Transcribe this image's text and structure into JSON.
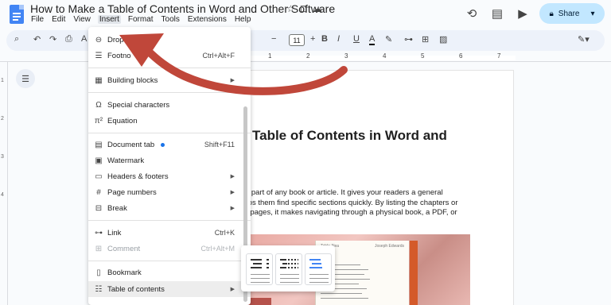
{
  "app": {
    "title": "How to Make a Table of Contents in Word and Other Software",
    "menus": [
      "File",
      "Edit",
      "View",
      "Insert",
      "Format",
      "Tools",
      "Extensions",
      "Help"
    ],
    "active_menu": "Insert",
    "share_label": "Share"
  },
  "toolbar": {
    "font_size": "11"
  },
  "ruler": {
    "numbers": [
      "1",
      "2",
      "3",
      "4",
      "5",
      "6",
      "7"
    ],
    "left_numbers": [
      "1",
      "2",
      "3",
      "4"
    ]
  },
  "document": {
    "heading": "Table of Contents in Word and",
    "body_lines": [
      "cial part of any book or article. It gives your readers a general",
      "helps them find specific sections quickly. By listing the chapters or",
      "ing pages, it makes navigating through a physical book, a PDF, or"
    ],
    "book_left_header": "Table Alea",
    "book_right_header": "Joseph Edwards"
  },
  "insert_menu": {
    "items": [
      {
        "icon": "dropdown-icon",
        "glyph": "⊖",
        "label": "Drop",
        "shortcut": ""
      },
      {
        "icon": "footnote-icon",
        "glyph": "☰",
        "label": "Footno",
        "shortcut": "Ctrl+Alt+F"
      },
      {
        "icon": "building-blocks-icon",
        "glyph": "▦",
        "label": "Building blocks",
        "submenu": true
      },
      {
        "icon": "omega-icon",
        "glyph": "Ω",
        "label": "Special characters"
      },
      {
        "icon": "equation-icon",
        "glyph": "π²",
        "label": "Equation"
      },
      {
        "icon": "document-tab-icon",
        "glyph": "▤",
        "label": "Document tab",
        "shortcut": "Shift+F11",
        "badge": true
      },
      {
        "icon": "watermark-icon",
        "glyph": "▣",
        "label": "Watermark"
      },
      {
        "icon": "headers-footers-icon",
        "glyph": "▭",
        "label": "Headers & footers",
        "submenu": true
      },
      {
        "icon": "page-numbers-icon",
        "glyph": "#",
        "label": "Page numbers",
        "submenu": true
      },
      {
        "icon": "break-icon",
        "glyph": "⊟",
        "label": "Break",
        "submenu": true
      },
      {
        "icon": "link-icon",
        "glyph": "⊶",
        "label": "Link",
        "shortcut": "Ctrl+K"
      },
      {
        "icon": "comment-icon",
        "glyph": "⊞",
        "label": "Comment",
        "shortcut": "Ctrl+Alt+M",
        "disabled": true
      },
      {
        "icon": "bookmark-icon",
        "glyph": "▯",
        "label": "Bookmark"
      },
      {
        "icon": "table-of-contents-icon",
        "glyph": "☷",
        "label": "Table of contents",
        "submenu": true,
        "highlighted": true
      }
    ]
  },
  "colors": {
    "share_bg": "#c2e7ff",
    "doc_blue": "#4285f4",
    "annotation_arrow": "#c0473a",
    "badge": "#1a73e8"
  }
}
